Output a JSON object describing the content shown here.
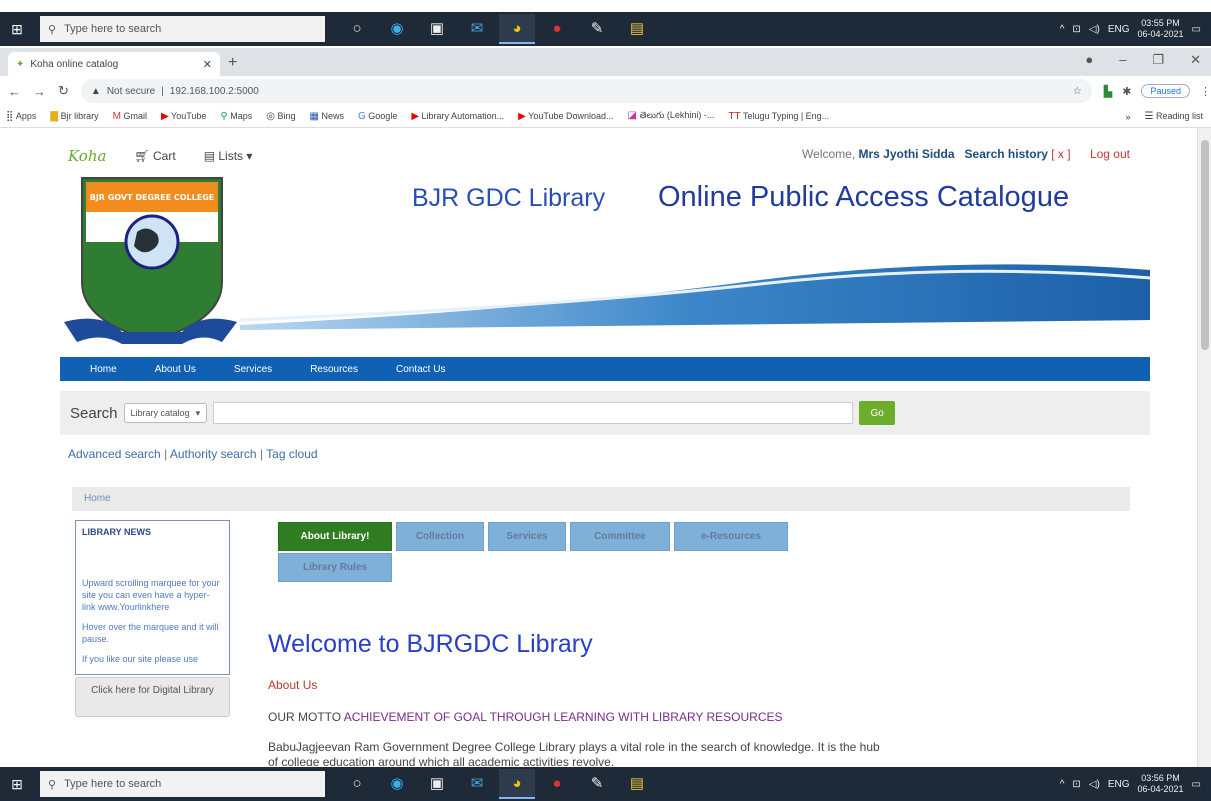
{
  "taskbar": {
    "search_placeholder": "Type here to search",
    "lang": "ENG",
    "top_time": "03:55 PM",
    "top_date": "06-04-2021",
    "bottom_time": "03:56 PM",
    "bottom_date": "06-04-2021"
  },
  "browser": {
    "tab_title": "Koha online catalog",
    "security_label": "Not secure",
    "url": "192.168.100.2:5000",
    "paused_label": "Paused",
    "bookmarks": [
      "Apps",
      "Bjr library",
      "Gmail",
      "YouTube",
      "Maps",
      "Bing",
      "News",
      "Google",
      "Library Automation...",
      "YouTube Download...",
      "తెలుగు (Lekhini) -...",
      "Telugu Typing | Eng..."
    ],
    "reading_list": "Reading list"
  },
  "site": {
    "logo_text": "Koha",
    "cart": "Cart",
    "lists": "Lists",
    "welcome_prefix": "Welcome, ",
    "user_name": "Mrs Jyothi Sidda",
    "search_history": "Search history",
    "clear_history": "[ x ]",
    "logout": "Log out",
    "banner_title": "BJR GDC Library",
    "banner_subtitle": "Online Public Access Catalogue",
    "college_logo_text": "BJR GOVT DEGREE COLLEGE",
    "menu": [
      "Home",
      "About Us",
      "Services",
      "Resources",
      "Contact Us"
    ],
    "search_label": "Search",
    "search_scope": "Library catalog",
    "go": "Go",
    "links": [
      "Advanced search",
      "Authority search",
      "Tag cloud"
    ],
    "breadcrumb": "Home"
  },
  "sidebar": {
    "news_title": "LIBRARY NEWS",
    "news_items": [
      "Upward scrolling marquee for your site you can even have a hyper-link www.Yourlinkhere",
      "Hover over the marquee and it will pause.",
      "If you like our site please use"
    ],
    "digital_button": "Click here for Digital Library"
  },
  "content": {
    "tabs": [
      "About Library!",
      "Collection",
      "Services",
      "Committee",
      "e-Resources",
      "Library Rules"
    ],
    "heading": "Welcome to BJRGDC Library",
    "about_link": "About Us",
    "motto_label": "OUR MOTTO",
    "motto_text": "ACHIEVEMENT OF GOAL THROUGH LEARNING WITH LIBRARY RESOURCES",
    "paragraph": "BabuJagjeevan Ram Government Degree College Library plays a vital role in the search of knowledge. It is the hub of college education around which all academic activities revolve."
  }
}
